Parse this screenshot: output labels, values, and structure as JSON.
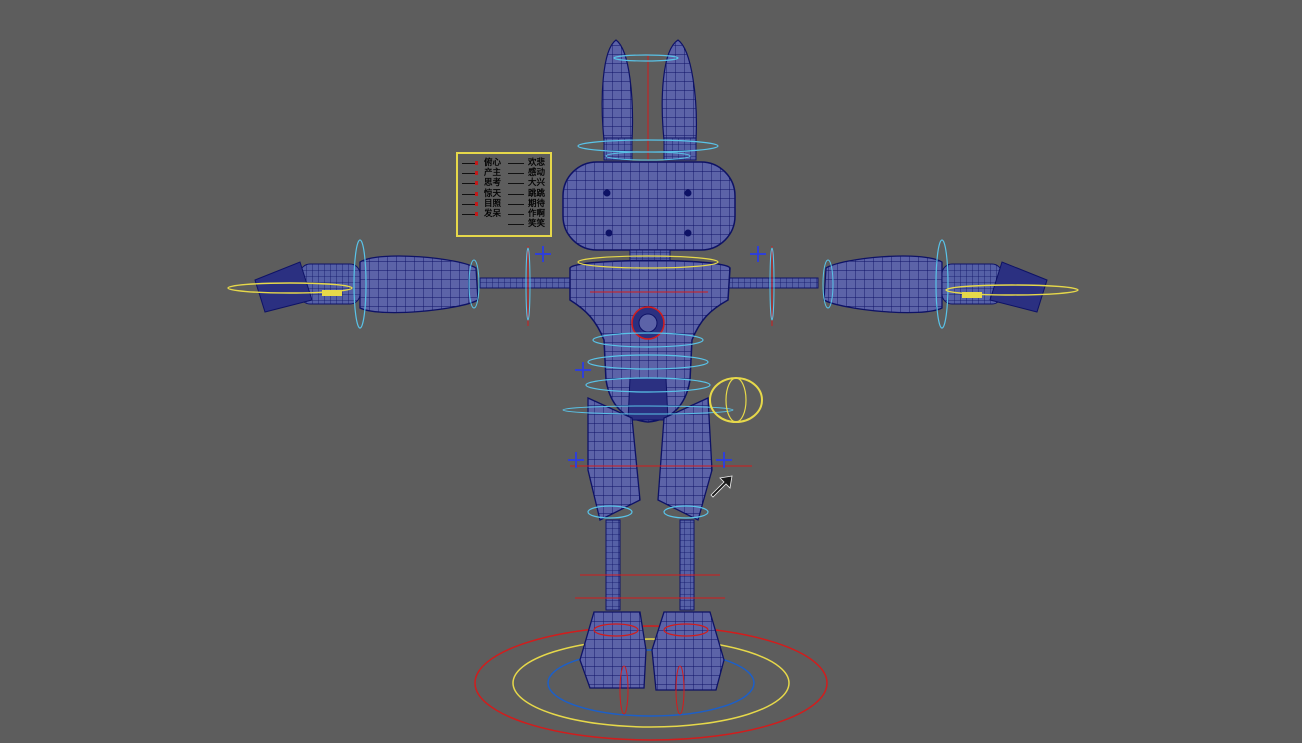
{
  "viewport": {
    "background": "#5d5d5d",
    "mesh_fill": "#5c63a8",
    "wire_color": "#0e1266",
    "control_colors": {
      "selected": "#e6d84a",
      "ik": "#d31c1c",
      "fk": "#59c3e8",
      "locator": "#2f3fd8",
      "ground_inner": "#1c5fc9"
    }
  },
  "facial_panel": {
    "left_labels": [
      "俯心",
      "产主",
      "思考",
      "惊天",
      "目照",
      "发呆"
    ],
    "right_labels": [
      "欢悲",
      "感动",
      "大兴",
      "跳跳",
      "期待",
      "作啊",
      "笑笑"
    ]
  },
  "icons": {
    "cursor": "mouse-cursor-icon",
    "locators": "plus-locator-icon"
  }
}
